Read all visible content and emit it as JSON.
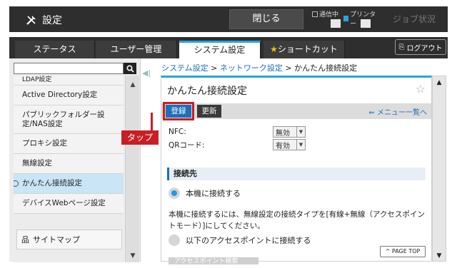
{
  "header": {
    "title": "設定",
    "close_label": "閉じる",
    "comm_label": "通信中",
    "printer_label": "プリンター",
    "job_status": "ジョブ状況"
  },
  "tabs": [
    {
      "label": "ステータス"
    },
    {
      "label": "ユーザー管理"
    },
    {
      "label": "システム設定"
    },
    {
      "label": "ショートカット"
    }
  ],
  "logout_label": "ログアウト",
  "sidebar": {
    "items": [
      {
        "label": "LDAP設定"
      },
      {
        "label": "Active Directory設定"
      },
      {
        "label": "パブリックフォルダー設定/NAS設定"
      },
      {
        "label": "プロキシ設定"
      },
      {
        "label": "無線設定"
      },
      {
        "label": "かんたん接続設定"
      },
      {
        "label": "デバイスWebページ設定"
      }
    ],
    "sitemap": "サイトマップ"
  },
  "breadcrumb": {
    "a": "システム設定",
    "b": "ネットワーク設定",
    "sep": ">",
    "cur": "かんたん接続設定"
  },
  "main": {
    "title": "かんたん接続設定",
    "register": "登録",
    "update": "更新",
    "menu_link": "メニュー一覧へ",
    "nfc_label": "NFC:",
    "nfc_value": "無効",
    "qr_label": "QRコード:",
    "qr_value": "有効",
    "section": "接続先",
    "option1": "本機に接続する",
    "description": "本機に接続するには、無線設定の接続タイプを[有線+無線（アクセスポイントモード）]にしてください。",
    "option2": "以下のアクセスポイントに接続する",
    "page_top": "PAGE TOP",
    "ap_search": "アクセスポイント検索"
  },
  "annotation": {
    "tap": "タップ"
  },
  "colors": {
    "accent": "#29a3e0",
    "primary_button": "#1d6fb8",
    "callout": "#c81f25"
  }
}
